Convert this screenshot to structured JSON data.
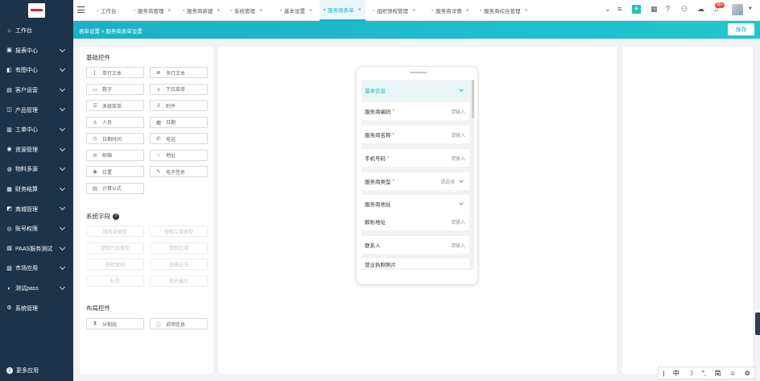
{
  "sidebar": {
    "items": [
      {
        "label": "工作台",
        "icon": "home-icon",
        "chevron": false
      },
      {
        "label": "报表中心",
        "icon": "report-icon",
        "chevron": true
      },
      {
        "label": "有图中心",
        "icon": "chart-icon",
        "chevron": true
      },
      {
        "label": "客户运营",
        "icon": "customer-icon",
        "chevron": true
      },
      {
        "label": "产品管理",
        "icon": "product-icon",
        "chevron": true
      },
      {
        "label": "工单中心",
        "icon": "ticket-icon",
        "chevron": true
      },
      {
        "label": "资源管理",
        "icon": "resource-icon",
        "chevron": true
      },
      {
        "label": "物料多源",
        "icon": "material-icon",
        "chevron": true
      },
      {
        "label": "财务结算",
        "icon": "finance-icon",
        "chevron": true
      },
      {
        "label": "商城管理",
        "icon": "shop-icon",
        "chevron": true
      },
      {
        "label": "账号权限",
        "icon": "account-icon",
        "chevron": true
      },
      {
        "label": "PAAS服务测试",
        "icon": "paas-icon",
        "chevron": true
      },
      {
        "label": "市场应用",
        "icon": "app-icon",
        "chevron": true
      },
      {
        "label": "测试pass",
        "icon": "test-icon",
        "chevron": true
      },
      {
        "label": "系统管理",
        "icon": "settings-icon",
        "chevron": false
      }
    ],
    "more_label": "更多应用"
  },
  "tabs": [
    {
      "label": "工作台",
      "closable": false,
      "active": false
    },
    {
      "label": "服务商管理",
      "closable": true,
      "active": false
    },
    {
      "label": "服务商新建",
      "closable": true,
      "active": false
    },
    {
      "label": "系统管理",
      "closable": true,
      "active": false
    },
    {
      "label": "基本设置",
      "closable": true,
      "active": false
    },
    {
      "label": "服务商表单",
      "closable": true,
      "active": true
    },
    {
      "label": "组织领权管理",
      "closable": true,
      "active": false
    },
    {
      "label": "服务商详情",
      "closable": true,
      "active": false
    },
    {
      "label": "服务商综合管理",
      "closable": true,
      "active": false
    }
  ],
  "topbar": {
    "notification_badge": "99+"
  },
  "subbar": {
    "breadcrumb": "表单设置 > 服务商表单设置",
    "save_label": "保存"
  },
  "basic_controls": {
    "title": "基础控件",
    "items": [
      {
        "label": "单行文本",
        "icon": "text-icon"
      },
      {
        "label": "多行文本",
        "icon": "textarea-icon"
      },
      {
        "label": "数字",
        "icon": "number-icon"
      },
      {
        "label": "下拉菜单",
        "icon": "dropdown-icon"
      },
      {
        "label": "多级菜单",
        "icon": "cascade-icon"
      },
      {
        "label": "附件",
        "icon": "attachment-icon"
      },
      {
        "label": "人员",
        "icon": "person-icon"
      },
      {
        "label": "日期",
        "icon": "calendar-icon"
      },
      {
        "label": "日期时间",
        "icon": "clock-icon"
      },
      {
        "label": "电话",
        "icon": "phone-icon"
      },
      {
        "label": "邮箱",
        "icon": "mail-icon"
      },
      {
        "label": "地址",
        "icon": "address-icon"
      },
      {
        "label": "位置",
        "icon": "location-icon"
      },
      {
        "label": "电子签名",
        "icon": "signature-icon"
      },
      {
        "label": "计算公式",
        "icon": "formula-icon"
      }
    ]
  },
  "system_fields": {
    "title": "系统字段",
    "items": [
      "服务商类型",
      "授权工单类型",
      "授权产品类型",
      "授权区域",
      "授权案例",
      "资质证书",
      "标签",
      "图片展示"
    ]
  },
  "layout_controls": {
    "title": "布局控件",
    "items": [
      {
        "label": "分割线",
        "icon": "divider-icon"
      },
      {
        "label": "说明信息",
        "icon": "info-icon"
      }
    ]
  },
  "preview": {
    "group_title": "基本信息",
    "fields": [
      {
        "label": "服务商编码",
        "required": true,
        "placeholder": "请输入",
        "type": "input"
      },
      {
        "label": "服务商名称",
        "required": true,
        "placeholder": "请输入",
        "type": "input"
      },
      {
        "label": "手机号码",
        "required": true,
        "placeholder": "请输入",
        "type": "input"
      },
      {
        "label": "服务商类型",
        "required": true,
        "placeholder": "请选择",
        "type": "select"
      },
      {
        "label": "服务商地址",
        "required": false,
        "placeholder": "",
        "type": "group"
      },
      {
        "label": "解析地址",
        "required": false,
        "placeholder": "请输入",
        "type": "input"
      },
      {
        "label": "联系人",
        "required": false,
        "placeholder": "请输入",
        "type": "input"
      },
      {
        "label": "营业执照照片",
        "required": false,
        "placeholder": "",
        "type": "partial"
      }
    ]
  },
  "ime": {
    "items": [
      "中",
      "☽",
      "°,",
      "简",
      "☺",
      "⚙"
    ]
  },
  "colors": {
    "sidebar": "#1c3349",
    "accent": "#1ab3c8",
    "required": "#e74c3c"
  }
}
